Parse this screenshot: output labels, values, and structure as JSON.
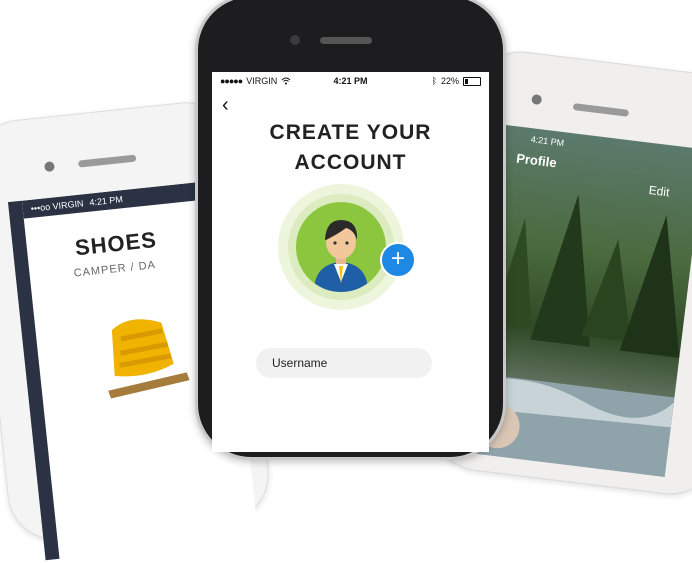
{
  "left_phone": {
    "status": {
      "carrier": "•••oo VIRGIN",
      "time": "4:21 PM"
    },
    "title": "SHOES",
    "subtitle": "CAMPER / DA"
  },
  "center_phone": {
    "status": {
      "carrier": "VIRGIN",
      "time": "4:21 PM",
      "battery": "22%"
    },
    "title_line1": "CREATE YOUR",
    "title_line2": "ACCOUNT",
    "username_placeholder": "Username"
  },
  "right_phone": {
    "status": {
      "time": "4:21 PM"
    },
    "title": "Profile",
    "edit_label": "Edit"
  },
  "colors": {
    "accent_blue": "#1e88e5",
    "avatar_green": "#8cc63f",
    "dark_sidebar": "#2a3244"
  },
  "icons": [
    "back-chevron-icon",
    "add-plus-icon",
    "user-icon",
    "wifi-icon",
    "bluetooth-icon",
    "battery-icon"
  ]
}
